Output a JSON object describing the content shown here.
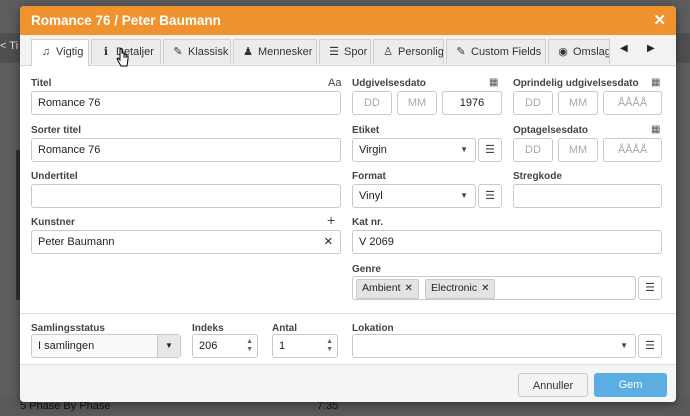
{
  "background": {
    "left_text": "< Ti",
    "bottom_track": "5  Phase By Phase",
    "bottom_duration": "7:35"
  },
  "dialog": {
    "title": "Romance 76 / Peter Baumann",
    "close_glyph": "✕"
  },
  "tabs": [
    {
      "label": "Vigtig",
      "icon": "music-note-icon",
      "glyph": "♫"
    },
    {
      "label": "Detaljer",
      "icon": "info-icon",
      "glyph": "ℹ"
    },
    {
      "label": "Klassisk",
      "icon": "violin-icon",
      "glyph": "✎"
    },
    {
      "label": "Mennesker",
      "icon": "people-icon",
      "glyph": "♟"
    },
    {
      "label": "Spor",
      "icon": "tracks-icon",
      "glyph": "☰"
    },
    {
      "label": "Personlig",
      "icon": "person-icon",
      "glyph": "♙"
    },
    {
      "label": "Custom Fields",
      "icon": "edit-icon",
      "glyph": "✎"
    },
    {
      "label": "Omslag",
      "icon": "camera-icon",
      "glyph": "◉"
    }
  ],
  "fields": {
    "title_label": "Titel",
    "title_value": "Romance 76",
    "sort_title_label": "Sorter titel",
    "sort_title_value": "Romance 76",
    "subtitle_label": "Undertitel",
    "subtitle_value": "",
    "artist_label": "Kunstner",
    "artist_value": "Peter Baumann",
    "release_label": "Udgivelsesdato",
    "release_dd": "DD",
    "release_mm": "MM",
    "release_year": "1976",
    "orig_release_label": "Oprindelig udgivelsesdato",
    "orig_dd": "DD",
    "orig_mm": "MM",
    "orig_year": "ÅÅÅÅ",
    "label_label": "Etiket",
    "label_value": "Virgin",
    "recording_label": "Optagelsesdato",
    "rec_dd": "DD",
    "rec_mm": "MM",
    "rec_year": "ÅÅÅÅ",
    "format_label": "Format",
    "format_value": "Vinyl",
    "barcode_label": "Stregkode",
    "barcode_value": "",
    "catno_label": "Kat nr.",
    "catno_value": "V 2069",
    "genre_label": "Genre",
    "genres": [
      "Ambient",
      "Electronic"
    ],
    "collection_status_label": "Samlingsstatus",
    "collection_status_value": "I samlingen",
    "index_label": "Indeks",
    "index_value": "206",
    "quantity_label": "Antal",
    "quantity_value": "1",
    "location_label": "Lokation",
    "location_value": ""
  },
  "footer": {
    "cancel_label": "Annuller",
    "save_label": "Gem"
  },
  "colors": {
    "accent": "#f0922e",
    "save": "#5aaee2"
  }
}
